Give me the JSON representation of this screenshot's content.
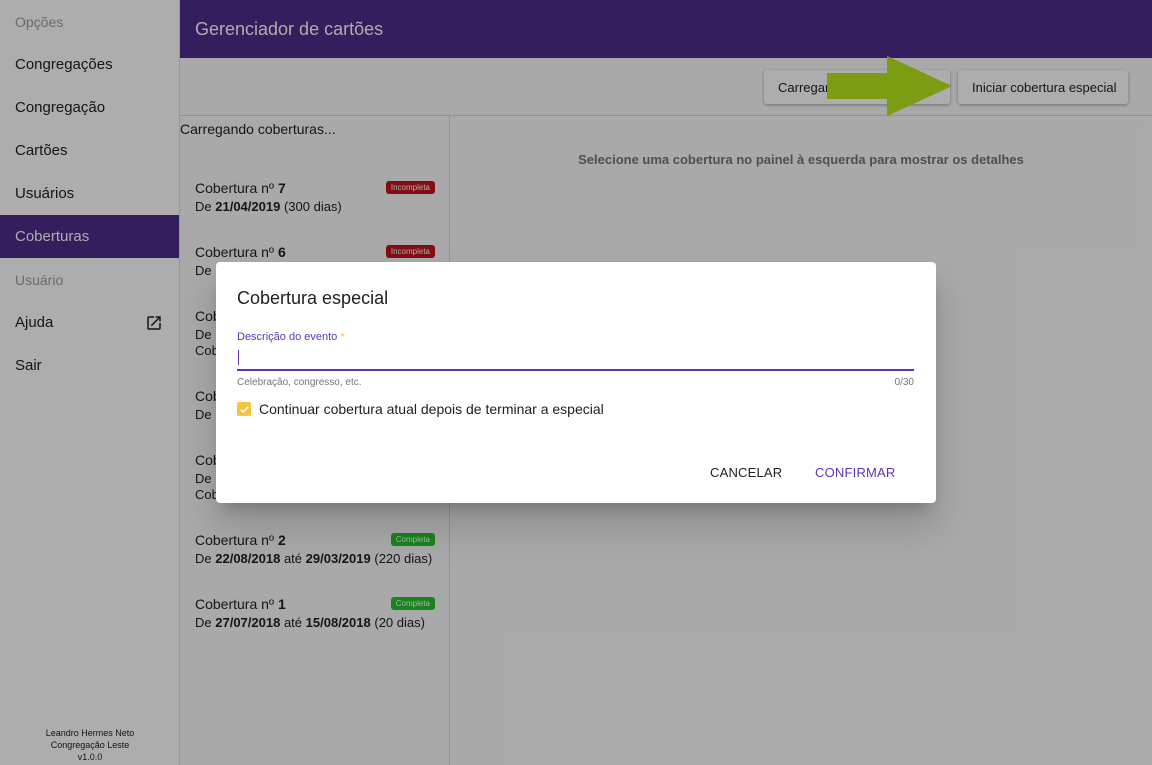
{
  "sidebar": {
    "options_header": "Opções",
    "items": [
      {
        "label": "Congregações"
      },
      {
        "label": "Congregação"
      },
      {
        "label": "Cartões"
      },
      {
        "label": "Usuários"
      },
      {
        "label": "Coberturas"
      }
    ],
    "user_header": "Usuário",
    "help_label": "Ajuda",
    "logout_label": "Sair",
    "footer": {
      "user_name": "Leandro Hermes Neto",
      "congregation": "Congregação Leste",
      "version": "v1.0.0"
    }
  },
  "header": {
    "title": "Gerenciador de cartões"
  },
  "toolbar": {
    "load_label": "Carregar coberturas",
    "start_special_label": "Iniciar cobertura especial"
  },
  "list": {
    "loading_text": "Carregando coberturas...",
    "title_prefix": "Cobertura nº",
    "items": [
      {
        "number": "7",
        "from_label": "De",
        "start": "21/04/2019",
        "until_label": "",
        "end": "",
        "days": "(300 dias)",
        "status": "Incompleta"
      },
      {
        "number": "6",
        "from_label": "De",
        "start": "",
        "until_label": "",
        "end": "",
        "days": "",
        "status": "Incompleta"
      },
      {
        "number": "",
        "from_label": "De",
        "start": "",
        "until_label": "",
        "end": "",
        "days": "",
        "status": "",
        "extra": "Cob"
      },
      {
        "number": "",
        "from_label": "De",
        "start": "",
        "until_label": "",
        "end": "",
        "days": "",
        "status": ""
      },
      {
        "number": "",
        "from_label": "De",
        "start": "",
        "until_label": "",
        "end": "",
        "days": "",
        "status": "",
        "extra": "Cob"
      },
      {
        "number": "2",
        "from_label": "De",
        "start": "22/08/2018",
        "until_label": "até",
        "end": "29/03/2019",
        "days": "(220 dias)",
        "status": "Completa"
      },
      {
        "number": "1",
        "from_label": "De",
        "start": "27/07/2018",
        "until_label": "até",
        "end": "15/08/2018",
        "days": "(20 dias)",
        "status": "Completa"
      }
    ]
  },
  "details": {
    "empty_message": "Selecione uma cobertura no painel à esquerda para mostrar os detalhes"
  },
  "dialog": {
    "title": "Cobertura especial",
    "field_label": "Descrição do evento",
    "required_mark": "*",
    "field_value": "",
    "field_hint": "Celebração, congresso, etc.",
    "field_counter": "0/30",
    "checkbox_label": "Continuar cobertura atual depois de terminar a especial",
    "checkbox_checked": true,
    "cancel_label": "CANCELAR",
    "confirm_label": "CONFIRMAR"
  },
  "colors": {
    "primary": "#4f2d8a",
    "accent": "#5e35b1",
    "checkbox": "#f4c63c",
    "badge_incomplete": "#c0161c",
    "badge_complete": "#23c32a",
    "arrow": "#b5e61d"
  }
}
